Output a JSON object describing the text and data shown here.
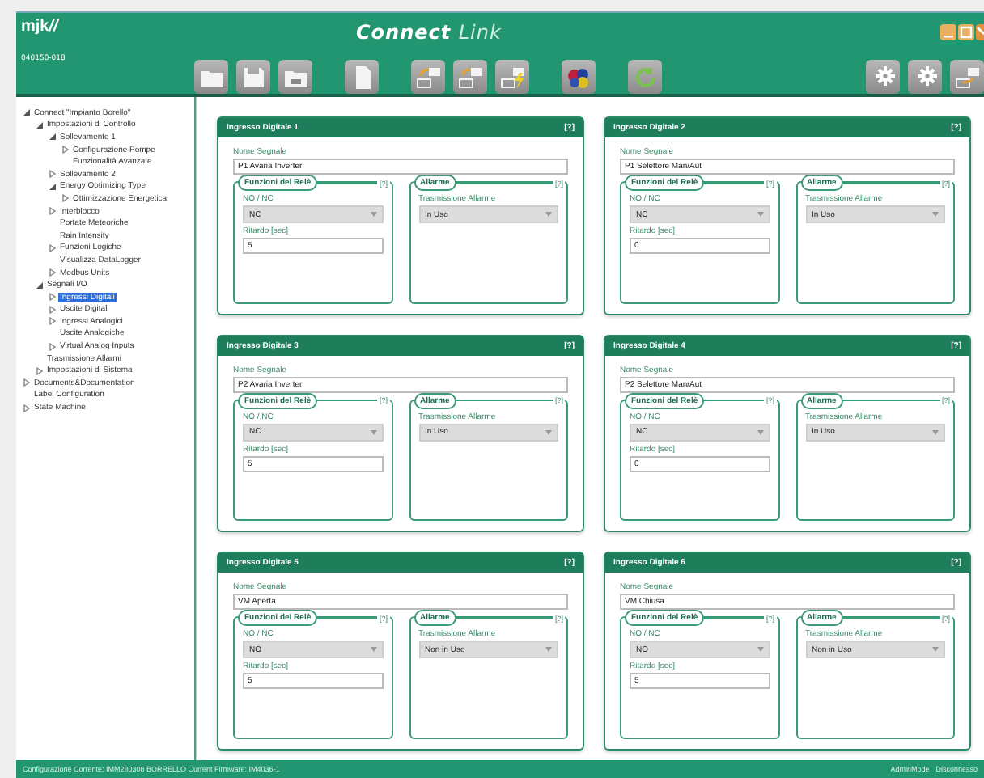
{
  "header": {
    "logo": "mjk",
    "logo_mark": "//",
    "title": "Connect",
    "title_accent": "Link",
    "device_code": "040150-018"
  },
  "tree": [
    {
      "label": "Connect \"Impianto Borello\"",
      "kind": "folder",
      "expanded": true,
      "selected": false,
      "children": [
        {
          "label": "Impostazioni di Controllo",
          "kind": "folder",
          "expanded": true,
          "selected": false,
          "children": [
            {
              "label": "Sollevamento 1",
              "kind": "folder",
              "expanded": true,
              "selected": false,
              "children": [
                {
                  "label": "Configurazione Pompe",
                  "kind": "folder",
                  "expanded": false,
                  "selected": false
                },
                {
                  "label": "Funzionalità Avanzate",
                  "kind": "leaf",
                  "selected": false
                }
              ]
            },
            {
              "label": "Sollevamento 2",
              "kind": "folder",
              "expanded": false,
              "selected": false
            },
            {
              "label": "Energy Optimizing Type",
              "kind": "folder",
              "expanded": true,
              "selected": false,
              "children": [
                {
                  "label": "Ottimizzazione Energetica",
                  "kind": "folder",
                  "expanded": false,
                  "selected": false
                }
              ]
            },
            {
              "label": "Interblocco",
              "kind": "folder",
              "expanded": false,
              "selected": false
            },
            {
              "label": "Portate Meteoriche",
              "kind": "leaf",
              "selected": false
            },
            {
              "label": "Rain Intensity",
              "kind": "leaf",
              "selected": false
            },
            {
              "label": "Funzioni Logiche",
              "kind": "folder",
              "expanded": false,
              "selected": false
            },
            {
              "label": "Visualizza DataLogger",
              "kind": "leaf",
              "selected": false
            },
            {
              "label": "Modbus Units",
              "kind": "folder",
              "expanded": false,
              "selected": false
            }
          ]
        },
        {
          "label": "Segnali I/O",
          "kind": "folder",
          "expanded": true,
          "selected": false,
          "children": [
            {
              "label": "Ingressi Digitali",
              "kind": "folder",
              "expanded": false,
              "selected": true
            },
            {
              "label": "Uscite Digitali",
              "kind": "folder",
              "expanded": false,
              "selected": false
            },
            {
              "label": "Ingressi Analogici",
              "kind": "folder",
              "expanded": false,
              "selected": false
            },
            {
              "label": "Uscite Analogiche",
              "kind": "leaf",
              "selected": false
            },
            {
              "label": "Virtual Analog Inputs",
              "kind": "folder",
              "expanded": false,
              "selected": false
            }
          ]
        },
        {
          "label": "Trasmissione Allarmi",
          "kind": "leaf",
          "selected": false
        },
        {
          "label": "Impostazioni di Sistema",
          "kind": "folder",
          "expanded": false,
          "selected": false
        }
      ]
    },
    {
      "label": "Documents&Documentation",
      "kind": "folder",
      "expanded": false,
      "selected": false
    },
    {
      "label": "Label Configuration",
      "kind": "leaf",
      "selected": false
    },
    {
      "label": "State Machine",
      "kind": "folder",
      "expanded": false,
      "selected": false
    }
  ],
  "cards": [
    {
      "title": "Ingresso Digitale 1",
      "help": "[?]",
      "name_label": "Nome Segnale",
      "name_value": "P1 Avaria Inverter",
      "relay_title": "Funzioni del Relè",
      "relay_help": "[?]",
      "nonc_label": "NO / NC",
      "nonc_value": "NC",
      "delay_label": "Ritardo [sec]",
      "delay_value": "5",
      "alarm_title": "Allarme",
      "alarm_help": "[?]",
      "alarm_label": "Trasmissione Allarme",
      "alarm_value": "In Uso"
    },
    {
      "title": "Ingresso Digitale 2",
      "help": "[?]",
      "name_label": "Nome Segnale",
      "name_value": "P1 Selettore Man/Aut",
      "relay_title": "Funzioni del Relè",
      "relay_help": "[?]",
      "nonc_label": "NO / NC",
      "nonc_value": "NC",
      "delay_label": "Ritardo [sec]",
      "delay_value": "0",
      "alarm_title": "Allarme",
      "alarm_help": "[?]",
      "alarm_label": "Trasmissione Allarme",
      "alarm_value": "In Uso"
    },
    {
      "title": "Ingresso Digitale 3",
      "help": "[?]",
      "name_label": "Nome Segnale",
      "name_value": "P2 Avaria Inverter",
      "relay_title": "Funzioni del Relè",
      "relay_help": "[?]",
      "nonc_label": "NO / NC",
      "nonc_value": "NC",
      "delay_label": "Ritardo [sec]",
      "delay_value": "5",
      "alarm_title": "Allarme",
      "alarm_help": "[?]",
      "alarm_label": "Trasmissione Allarme",
      "alarm_value": "In Uso"
    },
    {
      "title": "Ingresso Digitale 4",
      "help": "[?]",
      "name_label": "Nome Segnale",
      "name_value": "P2 Selettore Man/Aut",
      "relay_title": "Funzioni del Relè",
      "relay_help": "[?]",
      "nonc_label": "NO / NC",
      "nonc_value": "NC",
      "delay_label": "Ritardo [sec]",
      "delay_value": "0",
      "alarm_title": "Allarme",
      "alarm_help": "[?]",
      "alarm_label": "Trasmissione Allarme",
      "alarm_value": "In Uso"
    },
    {
      "title": "Ingresso Digitale 5",
      "help": "[?]",
      "name_label": "Nome Segnale",
      "name_value": "VM Aperta",
      "relay_title": "Funzioni del Relè",
      "relay_help": "[?]",
      "nonc_label": "NO / NC",
      "nonc_value": "NO",
      "delay_label": "Ritardo [sec]",
      "delay_value": "5",
      "alarm_title": "Allarme",
      "alarm_help": "[?]",
      "alarm_label": "Trasmissione Allarme",
      "alarm_value": "Non in Uso"
    },
    {
      "title": "Ingresso Digitale 6",
      "help": "[?]",
      "name_label": "Nome Segnale",
      "name_value": "VM Chiusa",
      "relay_title": "Funzioni del Relè",
      "relay_help": "[?]",
      "nonc_label": "NO / NC",
      "nonc_value": "NO",
      "delay_label": "Ritardo [sec]",
      "delay_value": "5",
      "alarm_title": "Allarme",
      "alarm_help": "[?]",
      "alarm_label": "Trasmissione Allarme",
      "alarm_value": "Non in Uso"
    }
  ],
  "status_bar": {
    "configuration": "Configurazione Corrente: IMM280308 BORRELLO Current Firmware: IM4036-1",
    "mode": "AdminMode",
    "connection": "Disconnesso"
  }
}
